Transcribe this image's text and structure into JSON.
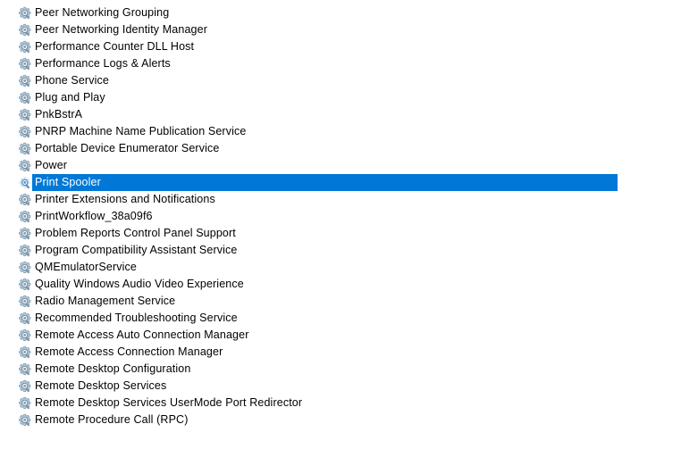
{
  "window": {
    "title": "Services",
    "background_color": "#ffffff"
  },
  "colors": {
    "selection_background": "#0078d7",
    "selection_text": "#ffffff",
    "text": "#000000",
    "icon_body": "#b8cbd9",
    "icon_outline": "#7a97ad",
    "icon_glass": "#6e8ca3"
  },
  "list": {
    "name": "services-list",
    "icon_name": "service-gear-icon",
    "selected_index": 10,
    "items": [
      {
        "label": "Peer Networking Grouping",
        "selected": false
      },
      {
        "label": "Peer Networking Identity Manager",
        "selected": false
      },
      {
        "label": "Performance Counter DLL Host",
        "selected": false
      },
      {
        "label": "Performance Logs & Alerts",
        "selected": false
      },
      {
        "label": "Phone Service",
        "selected": false
      },
      {
        "label": "Plug and Play",
        "selected": false
      },
      {
        "label": "PnkBstrA",
        "selected": false
      },
      {
        "label": "PNRP Machine Name Publication Service",
        "selected": false
      },
      {
        "label": "Portable Device Enumerator Service",
        "selected": false
      },
      {
        "label": "Power",
        "selected": false
      },
      {
        "label": "Print Spooler",
        "selected": true
      },
      {
        "label": "Printer Extensions and Notifications",
        "selected": false
      },
      {
        "label": "PrintWorkflow_38a09f6",
        "selected": false
      },
      {
        "label": "Problem Reports Control Panel Support",
        "selected": false
      },
      {
        "label": "Program Compatibility Assistant Service",
        "selected": false
      },
      {
        "label": "QMEmulatorService",
        "selected": false
      },
      {
        "label": "Quality Windows Audio Video Experience",
        "selected": false
      },
      {
        "label": "Radio Management Service",
        "selected": false
      },
      {
        "label": "Recommended Troubleshooting Service",
        "selected": false
      },
      {
        "label": "Remote Access Auto Connection Manager",
        "selected": false
      },
      {
        "label": "Remote Access Connection Manager",
        "selected": false
      },
      {
        "label": "Remote Desktop Configuration",
        "selected": false
      },
      {
        "label": "Remote Desktop Services",
        "selected": false
      },
      {
        "label": "Remote Desktop Services UserMode Port Redirector",
        "selected": false
      },
      {
        "label": "Remote Procedure Call (RPC)",
        "selected": false
      }
    ]
  }
}
